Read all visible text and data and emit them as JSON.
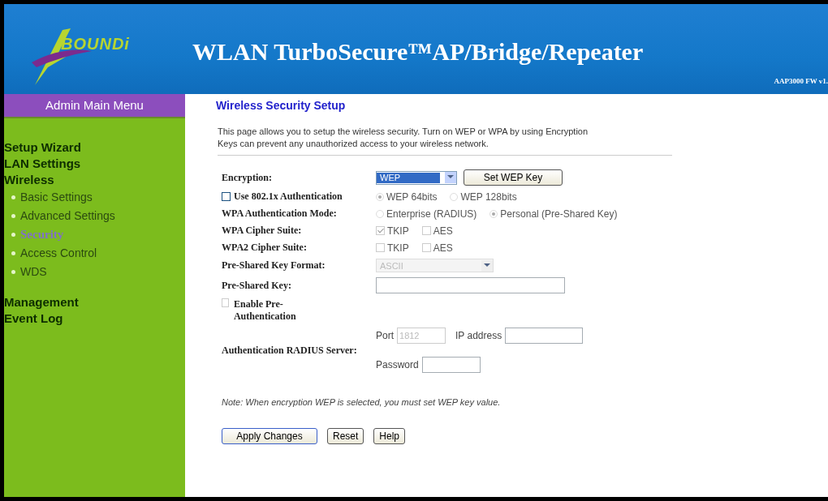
{
  "header": {
    "logo_text": "BOUNDi",
    "title": "WLAN TurboSecure™AP/Bridge/Repeater",
    "version": "AAP3000 FW v1."
  },
  "sidebar": {
    "title": "Admin Main Menu",
    "items": [
      {
        "label": "Setup Wizard",
        "selected": false
      },
      {
        "label": "LAN Settings",
        "selected": false
      },
      {
        "label": "Wireless",
        "selected": false,
        "children": [
          {
            "label": "Basic Settings",
            "selected": false
          },
          {
            "label": "Advanced Settings",
            "selected": false
          },
          {
            "label": "Security",
            "selected": true
          },
          {
            "label": "Access Control",
            "selected": false
          },
          {
            "label": "WDS",
            "selected": false
          }
        ]
      },
      {
        "label": "Management",
        "selected": false
      },
      {
        "label": "Event Log",
        "selected": false
      }
    ]
  },
  "page": {
    "title": "Wireless Security Setup",
    "intro": "This page allows you to setup the wireless security. Turn on WEP or WPA by using Encryption Keys can prevent any unauthorized access to your wireless network.",
    "encryption": {
      "label": "Encryption:",
      "value": "WEP",
      "button": "Set WEP Key"
    },
    "use_8021x": {
      "label": "Use 802.1x Authentication",
      "checked": false,
      "options": [
        {
          "label": "WEP 64bits",
          "selected": true,
          "disabled": true
        },
        {
          "label": "WEP 128bits",
          "selected": false,
          "disabled": true
        }
      ]
    },
    "wpa_mode": {
      "label": "WPA Authentication Mode:",
      "options": [
        {
          "label": "Enterprise (RADIUS)",
          "selected": false,
          "disabled": true
        },
        {
          "label": "Personal (Pre-Shared Key)",
          "selected": true,
          "disabled": true
        }
      ]
    },
    "wpa_cipher": {
      "label": "WPA Cipher Suite:",
      "options": [
        {
          "label": "TKIP",
          "checked": true,
          "disabled": true
        },
        {
          "label": "AES",
          "checked": false,
          "disabled": true
        }
      ]
    },
    "wpa2_cipher": {
      "label": "WPA2 Cipher Suite:",
      "options": [
        {
          "label": "TKIP",
          "checked": false,
          "disabled": true
        },
        {
          "label": "AES",
          "checked": false,
          "disabled": true
        }
      ]
    },
    "psk_format": {
      "label": "Pre-Shared Key Format:",
      "value": "ASCII",
      "disabled": true
    },
    "psk": {
      "label": "Pre-Shared Key:"
    },
    "preauth": {
      "label": "Enable Pre-Authentication",
      "checked": false,
      "disabled": true
    },
    "radius": {
      "label": "Authentication RADIUS Server:",
      "port_label": "Port",
      "port": "1812",
      "ip_label": "IP address",
      "password_label": "Password",
      "disabled": true
    },
    "note": "Note: When encryption WEP is selected, you must set WEP key value.",
    "buttons": [
      "Apply Changes",
      "Reset",
      "Help"
    ]
  }
}
